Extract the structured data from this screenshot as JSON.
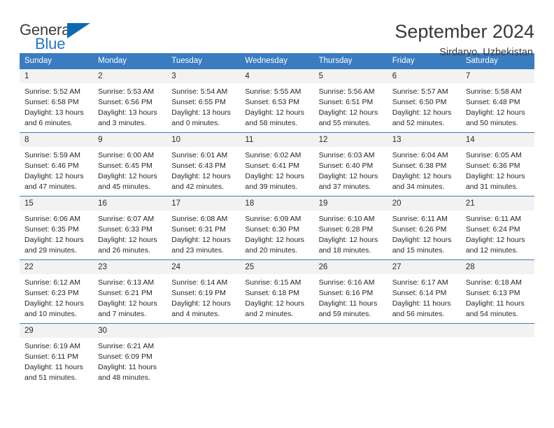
{
  "brand": {
    "name_part1": "General",
    "name_part2": "Blue",
    "flag_icon": "blue-flag-icon"
  },
  "header": {
    "title": "September 2024",
    "subtitle": "Sirdaryo, Uzbekistan"
  },
  "colors": {
    "header_blue": "#3a7cc0",
    "brand_blue": "#1f7ac4",
    "daynum_background": "#f2f2f2",
    "text": "#262626"
  },
  "weekday_headers": [
    "Sunday",
    "Monday",
    "Tuesday",
    "Wednesday",
    "Thursday",
    "Friday",
    "Saturday"
  ],
  "weeks": [
    [
      {
        "day": "1",
        "sunrise": "Sunrise: 5:52 AM",
        "sunset": "Sunset: 6:58 PM",
        "daylight_line1": "Daylight: 13 hours",
        "daylight_line2": "and 6 minutes."
      },
      {
        "day": "2",
        "sunrise": "Sunrise: 5:53 AM",
        "sunset": "Sunset: 6:56 PM",
        "daylight_line1": "Daylight: 13 hours",
        "daylight_line2": "and 3 minutes."
      },
      {
        "day": "3",
        "sunrise": "Sunrise: 5:54 AM",
        "sunset": "Sunset: 6:55 PM",
        "daylight_line1": "Daylight: 13 hours",
        "daylight_line2": "and 0 minutes."
      },
      {
        "day": "4",
        "sunrise": "Sunrise: 5:55 AM",
        "sunset": "Sunset: 6:53 PM",
        "daylight_line1": "Daylight: 12 hours",
        "daylight_line2": "and 58 minutes."
      },
      {
        "day": "5",
        "sunrise": "Sunrise: 5:56 AM",
        "sunset": "Sunset: 6:51 PM",
        "daylight_line1": "Daylight: 12 hours",
        "daylight_line2": "and 55 minutes."
      },
      {
        "day": "6",
        "sunrise": "Sunrise: 5:57 AM",
        "sunset": "Sunset: 6:50 PM",
        "daylight_line1": "Daylight: 12 hours",
        "daylight_line2": "and 52 minutes."
      },
      {
        "day": "7",
        "sunrise": "Sunrise: 5:58 AM",
        "sunset": "Sunset: 6:48 PM",
        "daylight_line1": "Daylight: 12 hours",
        "daylight_line2": "and 50 minutes."
      }
    ],
    [
      {
        "day": "8",
        "sunrise": "Sunrise: 5:59 AM",
        "sunset": "Sunset: 6:46 PM",
        "daylight_line1": "Daylight: 12 hours",
        "daylight_line2": "and 47 minutes."
      },
      {
        "day": "9",
        "sunrise": "Sunrise: 6:00 AM",
        "sunset": "Sunset: 6:45 PM",
        "daylight_line1": "Daylight: 12 hours",
        "daylight_line2": "and 45 minutes."
      },
      {
        "day": "10",
        "sunrise": "Sunrise: 6:01 AM",
        "sunset": "Sunset: 6:43 PM",
        "daylight_line1": "Daylight: 12 hours",
        "daylight_line2": "and 42 minutes."
      },
      {
        "day": "11",
        "sunrise": "Sunrise: 6:02 AM",
        "sunset": "Sunset: 6:41 PM",
        "daylight_line1": "Daylight: 12 hours",
        "daylight_line2": "and 39 minutes."
      },
      {
        "day": "12",
        "sunrise": "Sunrise: 6:03 AM",
        "sunset": "Sunset: 6:40 PM",
        "daylight_line1": "Daylight: 12 hours",
        "daylight_line2": "and 37 minutes."
      },
      {
        "day": "13",
        "sunrise": "Sunrise: 6:04 AM",
        "sunset": "Sunset: 6:38 PM",
        "daylight_line1": "Daylight: 12 hours",
        "daylight_line2": "and 34 minutes."
      },
      {
        "day": "14",
        "sunrise": "Sunrise: 6:05 AM",
        "sunset": "Sunset: 6:36 PM",
        "daylight_line1": "Daylight: 12 hours",
        "daylight_line2": "and 31 minutes."
      }
    ],
    [
      {
        "day": "15",
        "sunrise": "Sunrise: 6:06 AM",
        "sunset": "Sunset: 6:35 PM",
        "daylight_line1": "Daylight: 12 hours",
        "daylight_line2": "and 29 minutes."
      },
      {
        "day": "16",
        "sunrise": "Sunrise: 6:07 AM",
        "sunset": "Sunset: 6:33 PM",
        "daylight_line1": "Daylight: 12 hours",
        "daylight_line2": "and 26 minutes."
      },
      {
        "day": "17",
        "sunrise": "Sunrise: 6:08 AM",
        "sunset": "Sunset: 6:31 PM",
        "daylight_line1": "Daylight: 12 hours",
        "daylight_line2": "and 23 minutes."
      },
      {
        "day": "18",
        "sunrise": "Sunrise: 6:09 AM",
        "sunset": "Sunset: 6:30 PM",
        "daylight_line1": "Daylight: 12 hours",
        "daylight_line2": "and 20 minutes."
      },
      {
        "day": "19",
        "sunrise": "Sunrise: 6:10 AM",
        "sunset": "Sunset: 6:28 PM",
        "daylight_line1": "Daylight: 12 hours",
        "daylight_line2": "and 18 minutes."
      },
      {
        "day": "20",
        "sunrise": "Sunrise: 6:11 AM",
        "sunset": "Sunset: 6:26 PM",
        "daylight_line1": "Daylight: 12 hours",
        "daylight_line2": "and 15 minutes."
      },
      {
        "day": "21",
        "sunrise": "Sunrise: 6:11 AM",
        "sunset": "Sunset: 6:24 PM",
        "daylight_line1": "Daylight: 12 hours",
        "daylight_line2": "and 12 minutes."
      }
    ],
    [
      {
        "day": "22",
        "sunrise": "Sunrise: 6:12 AM",
        "sunset": "Sunset: 6:23 PM",
        "daylight_line1": "Daylight: 12 hours",
        "daylight_line2": "and 10 minutes."
      },
      {
        "day": "23",
        "sunrise": "Sunrise: 6:13 AM",
        "sunset": "Sunset: 6:21 PM",
        "daylight_line1": "Daylight: 12 hours",
        "daylight_line2": "and 7 minutes."
      },
      {
        "day": "24",
        "sunrise": "Sunrise: 6:14 AM",
        "sunset": "Sunset: 6:19 PM",
        "daylight_line1": "Daylight: 12 hours",
        "daylight_line2": "and 4 minutes."
      },
      {
        "day": "25",
        "sunrise": "Sunrise: 6:15 AM",
        "sunset": "Sunset: 6:18 PM",
        "daylight_line1": "Daylight: 12 hours",
        "daylight_line2": "and 2 minutes."
      },
      {
        "day": "26",
        "sunrise": "Sunrise: 6:16 AM",
        "sunset": "Sunset: 6:16 PM",
        "daylight_line1": "Daylight: 11 hours",
        "daylight_line2": "and 59 minutes."
      },
      {
        "day": "27",
        "sunrise": "Sunrise: 6:17 AM",
        "sunset": "Sunset: 6:14 PM",
        "daylight_line1": "Daylight: 11 hours",
        "daylight_line2": "and 56 minutes."
      },
      {
        "day": "28",
        "sunrise": "Sunrise: 6:18 AM",
        "sunset": "Sunset: 6:13 PM",
        "daylight_line1": "Daylight: 11 hours",
        "daylight_line2": "and 54 minutes."
      }
    ],
    [
      {
        "day": "29",
        "sunrise": "Sunrise: 6:19 AM",
        "sunset": "Sunset: 6:11 PM",
        "daylight_line1": "Daylight: 11 hours",
        "daylight_line2": "and 51 minutes."
      },
      {
        "day": "30",
        "sunrise": "Sunrise: 6:21 AM",
        "sunset": "Sunset: 6:09 PM",
        "daylight_line1": "Daylight: 11 hours",
        "daylight_line2": "and 48 minutes."
      },
      {
        "day": "",
        "sunrise": "",
        "sunset": "",
        "daylight_line1": "",
        "daylight_line2": ""
      },
      {
        "day": "",
        "sunrise": "",
        "sunset": "",
        "daylight_line1": "",
        "daylight_line2": ""
      },
      {
        "day": "",
        "sunrise": "",
        "sunset": "",
        "daylight_line1": "",
        "daylight_line2": ""
      },
      {
        "day": "",
        "sunrise": "",
        "sunset": "",
        "daylight_line1": "",
        "daylight_line2": ""
      },
      {
        "day": "",
        "sunrise": "",
        "sunset": "",
        "daylight_line1": "",
        "daylight_line2": ""
      }
    ]
  ]
}
